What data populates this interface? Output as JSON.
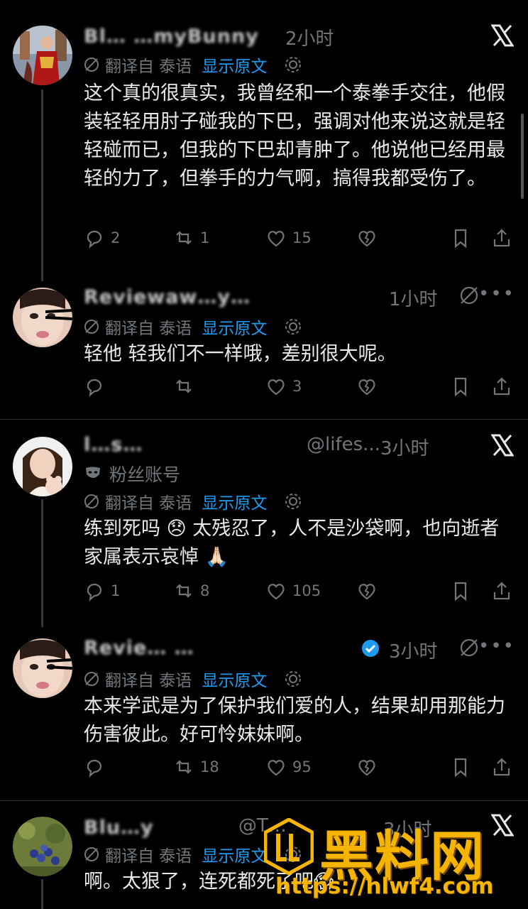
{
  "common": {
    "translate_label": "翻译自 泰语",
    "show_original": "显示原文"
  },
  "posts": [
    {
      "name": "Bl…  …myBunny",
      "handle": "",
      "time": "2小时",
      "text": "这个真的很真实，我曾经和一个泰拳手交往，他假装轻轻用肘子碰我的下巴，强调对他来说这就是轻轻碰而已，但我的下巴却青肿了。他说他已经用最轻的力了，但拳手的力气啊，搞得我都受伤了。",
      "reply_count": "2",
      "repost_count": "1",
      "like_count": "15"
    },
    {
      "name": "Reviewaw…y…",
      "handle": "",
      "time": "1小时",
      "text": "轻他 轻我们不一样哦，差别很大呢。",
      "reply_count": "",
      "repost_count": "",
      "like_count": "3"
    },
    {
      "name": "l…s…",
      "handle": "@lifes...",
      "time": "3小时",
      "fan_label": "粉丝账号",
      "text": "练到死吗 😞 太残忍了，人不是沙袋啊，也向逝者家属表示哀悼 🙏🏻",
      "reply_count": "1",
      "repost_count": "8",
      "like_count": "105"
    },
    {
      "name": "Revie…  …",
      "handle": "",
      "time": "3小时",
      "text": "本来学武是为了保护我们爱的人，结果却用那能力伤害彼此。好可怜妹妹啊。",
      "reply_count": "",
      "repost_count": "18",
      "like_count": "95"
    },
    {
      "name": "Blu…y",
      "handle": "@T…",
      "time": "3小时",
      "text": "啊。太狠了，连死都死了吧😱",
      "reply_count": "",
      "repost_count": "",
      "like_count": ""
    }
  ],
  "watermark": {
    "title": "黑料网",
    "url": "https://hlwf4.com"
  },
  "colors": {
    "background": "#000000",
    "text": "#e7e9ea",
    "muted": "#71767b",
    "link": "#1d9bf0",
    "watermark": "#f5b400"
  }
}
